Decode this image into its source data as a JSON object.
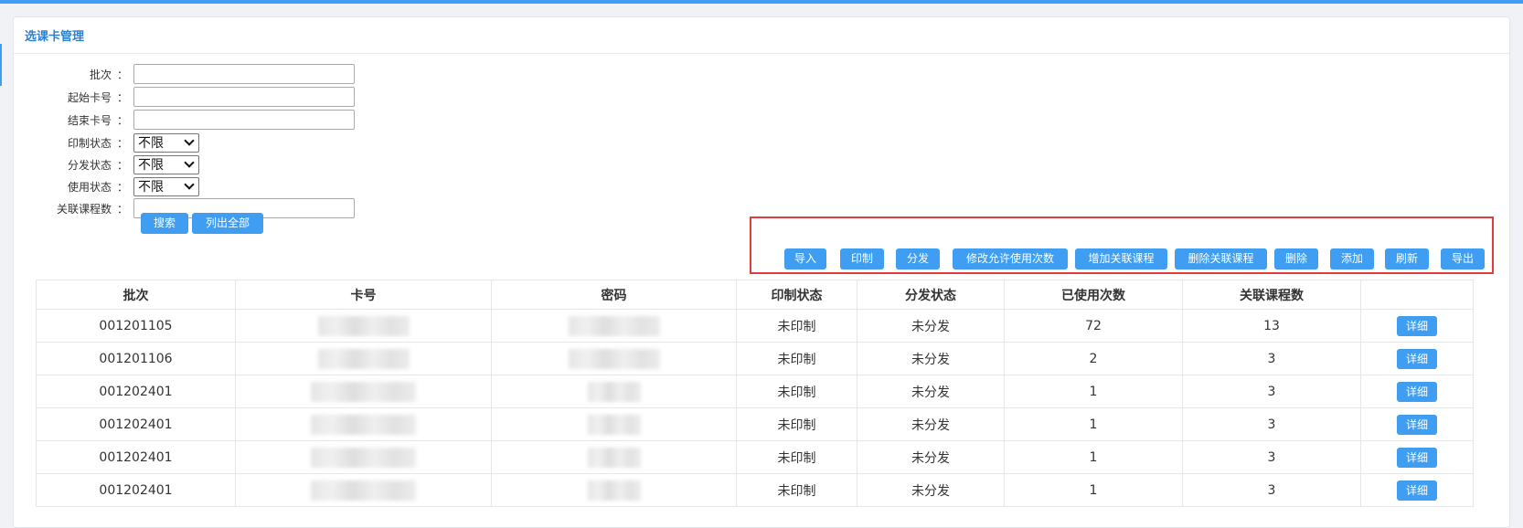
{
  "panel": {
    "title": "选课卡管理"
  },
  "form": {
    "batch_label": "批次",
    "start_card_label": "起始卡号",
    "end_card_label": "结束卡号",
    "print_status_label": "印制状态",
    "print_status_value": "不限",
    "distribute_status_label": "分发状态",
    "distribute_status_value": "不限",
    "use_status_label": "使用状态",
    "use_status_value": "不限",
    "course_count_label": "关联课程数",
    "colon": "：",
    "search_button": "搜索",
    "list_all_button": "列出全部"
  },
  "toolbar": {
    "import": "导入",
    "print": "印制",
    "distribute": "分发",
    "modify_uses": "修改允许使用次数",
    "add_course": "增加关联课程",
    "remove_course": "删除关联课程",
    "delete": "删除",
    "add": "添加",
    "refresh": "刷新",
    "export": "导出"
  },
  "table": {
    "headers": [
      "批次",
      "卡号",
      "密码",
      "印制状态",
      "分发状态",
      "已使用次数",
      "关联课程数",
      ""
    ],
    "detail_label": "详细",
    "rows": [
      {
        "batch": "001201105",
        "print": "未印制",
        "distribute": "未分发",
        "used": "72",
        "courses": "13"
      },
      {
        "batch": "001201106",
        "print": "未印制",
        "distribute": "未分发",
        "used": "2",
        "courses": "3"
      },
      {
        "batch": "001202401",
        "print": "未印制",
        "distribute": "未分发",
        "used": "1",
        "courses": "3"
      },
      {
        "batch": "001202401",
        "print": "未印制",
        "distribute": "未分发",
        "used": "1",
        "courses": "3"
      },
      {
        "batch": "001202401",
        "print": "未印制",
        "distribute": "未分发",
        "used": "1",
        "courses": "3"
      },
      {
        "batch": "001202401",
        "print": "未印制",
        "distribute": "未分发",
        "used": "1",
        "courses": "3"
      }
    ]
  },
  "colors": {
    "accent": "#3f9df2",
    "highlight": "#e23b3b"
  }
}
